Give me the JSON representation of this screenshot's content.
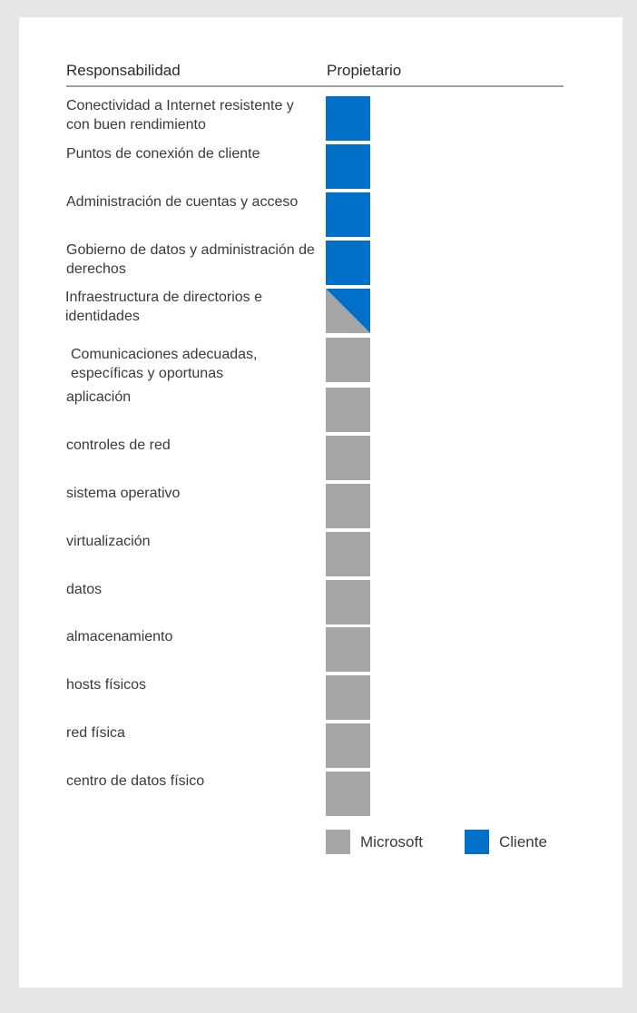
{
  "header": {
    "responsibility": "Responsabilidad",
    "owner": "Propietario"
  },
  "colors": {
    "microsoft": "#a6a6a6",
    "customer": "#0070c8"
  },
  "rows": [
    {
      "label": "Conectividad a Internet resistente y con buen rendimiento",
      "owner": "customer"
    },
    {
      "label": "Puntos de conexión de cliente",
      "owner": "customer"
    },
    {
      "label": "Administración de cuentas y acceso",
      "owner": "customer"
    },
    {
      "label": "Gobierno de datos y administración de derechos",
      "owner": "customer"
    },
    {
      "label": "Infraestructura de directorios e identidades",
      "owner": "shared"
    },
    {
      "label": "Comunicaciones adecuadas, específicas y oportunas",
      "owner": "microsoft"
    },
    {
      "label": "aplicación",
      "owner": "microsoft"
    },
    {
      "label": "controles de red",
      "owner": "microsoft"
    },
    {
      "label": "sistema operativo",
      "owner": "microsoft"
    },
    {
      "label": "virtualización",
      "owner": "microsoft"
    },
    {
      "label": "datos",
      "owner": "microsoft"
    },
    {
      "label": "almacenamiento",
      "owner": "microsoft"
    },
    {
      "label": "hosts físicos",
      "owner": "microsoft"
    },
    {
      "label": "red física",
      "owner": "microsoft"
    },
    {
      "label": "centro de datos físico",
      "owner": "microsoft"
    }
  ],
  "legend": {
    "microsoft": "Microsoft",
    "customer": "Cliente"
  }
}
